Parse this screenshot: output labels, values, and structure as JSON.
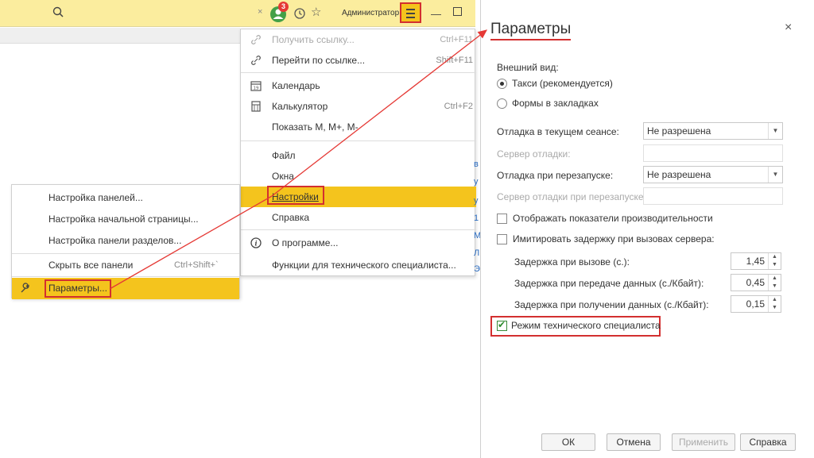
{
  "topbar": {
    "notifications_count": "3",
    "user_name": "Администратор",
    "close_glyph": "×"
  },
  "main_menu": {
    "items": [
      {
        "label": "Получить ссылку...",
        "shortcut": "Ctrl+F11",
        "icon": "link-icon",
        "disabled": true
      },
      {
        "label": "Перейти по ссылке...",
        "shortcut": "Shift+F11",
        "icon": "follow-link-icon"
      },
      {
        "label": "Календарь",
        "shortcut": "",
        "icon": "calendar-icon"
      },
      {
        "label": "Калькулятор",
        "shortcut": "Ctrl+F2",
        "icon": "calculator-icon"
      },
      {
        "label": "Показать M, M+, M-",
        "shortcut": "",
        "icon": ""
      },
      {
        "label": "Файл",
        "shortcut": "",
        "icon": ""
      },
      {
        "label": "Окна",
        "shortcut": "",
        "icon": ""
      },
      {
        "label": "Настройки",
        "shortcut": "",
        "icon": "",
        "active": true
      },
      {
        "label": "Справка",
        "shortcut": "",
        "icon": ""
      },
      {
        "label": "О программе...",
        "shortcut": "",
        "icon": "info-icon"
      },
      {
        "label": "Функции для технического специалиста...",
        "shortcut": "",
        "icon": ""
      }
    ]
  },
  "side_menu": {
    "items": [
      {
        "label": "Настройка панелей...",
        "shortcut": ""
      },
      {
        "label": "Настройка начальной страницы...",
        "shortcut": ""
      },
      {
        "label": "Настройка панели разделов...",
        "shortcut": ""
      },
      {
        "label": "Скрыть все панели",
        "shortcut": "Ctrl+Shift+`"
      },
      {
        "label": "Параметры...",
        "shortcut": "",
        "active": true,
        "icon": "wrench-icon"
      }
    ]
  },
  "dialog": {
    "title": "Параметры",
    "close_glyph": "×",
    "appearance_label": "Внешний вид:",
    "radio_taxi": "Такси (рекомендуется)",
    "radio_tabs": "Формы в закладках",
    "debug_session_label": "Отладка в текущем сеансе:",
    "debug_session_value": "Не разрешена",
    "debug_server_label": "Сервер отладки:",
    "debug_restart_label": "Отладка при перезапуске:",
    "debug_restart_value": "Не разрешена",
    "debug_restart_server_label": "Сервер отладки при перезапуске:",
    "show_perf_label": "Отображать показатели производительности",
    "imitate_delay_label": "Имитировать задержку при вызовах сервера:",
    "delay_call_label": "Задержка при вызове (с.):",
    "delay_call_value": "1,45",
    "delay_send_label": "Задержка при передаче данных (с./Кбайт):",
    "delay_send_value": "0,45",
    "delay_recv_label": "Задержка при получении данных (с./Кбайт):",
    "delay_recv_value": "0,15",
    "tech_mode_label": "Режим технического специалиста",
    "buttons": {
      "ok": "ОК",
      "cancel": "Отмена",
      "apply": "Применить",
      "help": "Справка"
    }
  },
  "edge_links": [
    "в",
    "у",
    "у",
    "1",
    "М",
    "Л",
    "Э"
  ]
}
